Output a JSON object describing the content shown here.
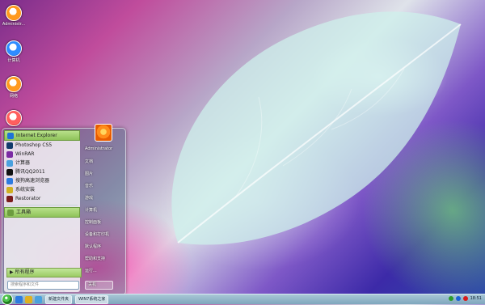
{
  "desktop": {
    "icons": [
      {
        "label": "Administr...",
        "color": "#ff8a00"
      },
      {
        "label": "计算机",
        "color": "#2f8cff"
      },
      {
        "label": "网络",
        "color": "#ff8a00"
      },
      {
        "label": "",
        "color": "#ff3b3b"
      }
    ]
  },
  "start_menu": {
    "programs": [
      {
        "label": "Internet Explorer",
        "color": "#1e73d8",
        "selected": true
      },
      {
        "label": "Photoshop CS5",
        "color": "#123a6b"
      },
      {
        "label": "WinRAR",
        "color": "#7b2aa3"
      },
      {
        "label": "计算器",
        "color": "#4aa1de"
      },
      {
        "label": "腾讯QQ2011",
        "color": "#111111"
      },
      {
        "label": "搜狗高速浏览器",
        "color": "#2d7be0"
      },
      {
        "label": "系统安装",
        "color": "#d0b020"
      },
      {
        "label": "Restorator",
        "color": "#7a1b1b"
      }
    ],
    "program_highlight": "工具箱",
    "all_programs": "所有程序",
    "search_placeholder": "搜索程序和文件",
    "right_items": [
      "Administrator",
      "文档",
      "图片",
      "音乐",
      "游戏",
      "计算机",
      "控制面板",
      "设备和打印机",
      "默认程序",
      "帮助和支持",
      "运行..."
    ],
    "shutdown_label": "关机"
  },
  "taskbar": {
    "tasks": [
      "新建文件夹",
      "WIN7系统之家"
    ],
    "clock": "18:51"
  }
}
